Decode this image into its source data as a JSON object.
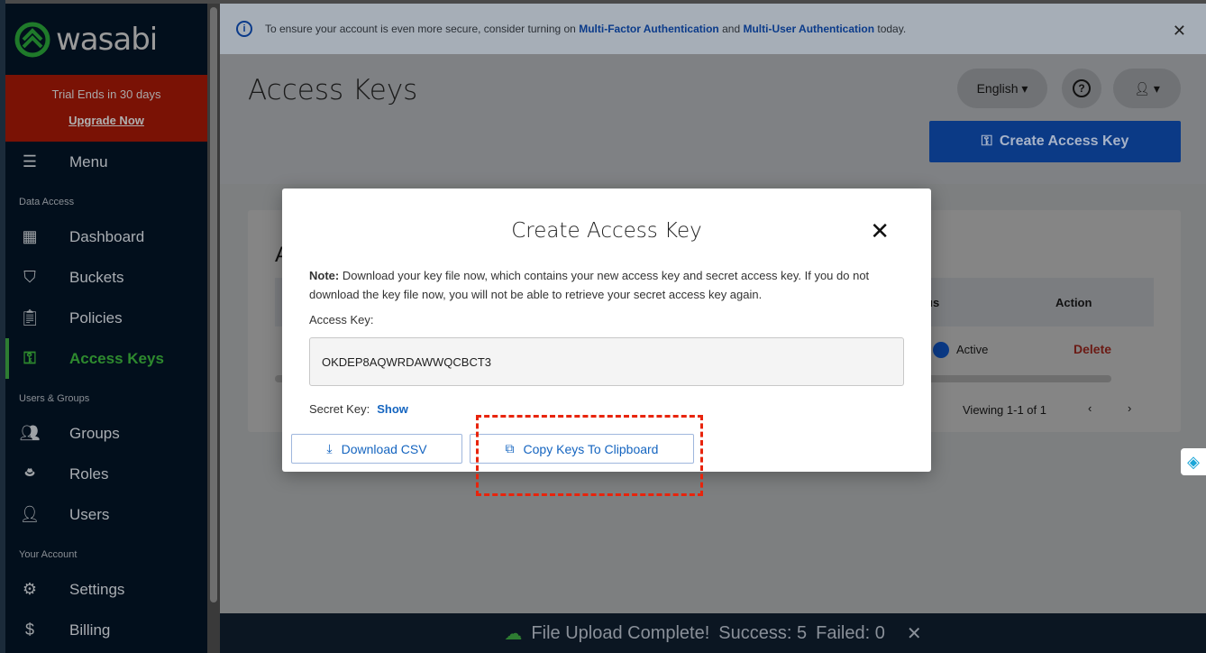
{
  "sidebar": {
    "brand": "wasabi",
    "trial_text": "Trial Ends in 30 days",
    "upgrade_label": "Upgrade Now",
    "menu_label": "Menu",
    "sections": {
      "data_access": "Data Access",
      "users_groups": "Users & Groups",
      "your_account": "Your Account"
    },
    "items": [
      {
        "label": "Dashboard",
        "icon": "dashboard-icon"
      },
      {
        "label": "Buckets",
        "icon": "bucket-icon"
      },
      {
        "label": "Policies",
        "icon": "clipboard-icon"
      },
      {
        "label": "Access Keys",
        "icon": "key-icon",
        "active": true
      },
      {
        "label": "Groups",
        "icon": "groups-icon"
      },
      {
        "label": "Roles",
        "icon": "hat-icon"
      },
      {
        "label": "Users",
        "icon": "users-icon"
      },
      {
        "label": "Settings",
        "icon": "gear-icon"
      },
      {
        "label": "Billing",
        "icon": "dollar-icon"
      }
    ]
  },
  "banner": {
    "prefix": "To ensure your account is even more secure, consider turning on ",
    "link1": "Multi-Factor Authentication",
    "mid": " and ",
    "link2": "Multi-User Authentication",
    "suffix": " today."
  },
  "header": {
    "title": "Access Keys",
    "language": "English",
    "create_button": "Create Access Key"
  },
  "table": {
    "partial_header": "us",
    "action_header": "Action",
    "status": "Active",
    "delete": "Delete",
    "viewing": "Viewing 1-1 of 1",
    "partial_title": "A"
  },
  "modal": {
    "title": "Create Access Key",
    "note_label": "Note:",
    "note_text": " Download your key file now, which contains your new access key and secret access key. If you do not download the key file now, you will not be able to retrieve your secret access key again.",
    "access_key_label": "Access Key:",
    "access_key_value": "OKDEP8AQWRDAWWQCBCT3",
    "secret_key_label": "Secret Key:",
    "show_label": "Show",
    "download_label": "Download CSV",
    "copy_label": "Copy Keys To Clipboard"
  },
  "toast": {
    "title": "File Upload Complete!",
    "success": "Success: 5",
    "failed": "Failed: 0"
  },
  "colors": {
    "accent": "#1565c0",
    "active_nav": "#2e7d32",
    "delete": "#c62828",
    "highlight": "#e8240c"
  }
}
